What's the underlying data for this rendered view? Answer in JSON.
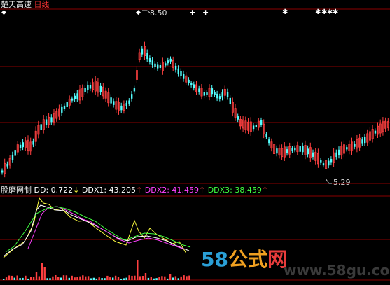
{
  "header": {
    "stock_name": "楚天高速",
    "period": "日线"
  },
  "price_panel": {
    "max_label": "8.50",
    "min_label": "5.29",
    "colors": {
      "up": "#ff4040",
      "down": "#54ffff",
      "grid": "#8b0000"
    },
    "signal_marker": "diamond-icon",
    "signal_star_marker": "star-icon"
  },
  "indicator_panel": {
    "name": "股磨网制",
    "dd_label": "DD:",
    "dd_value": "0.722",
    "dd_arrow": "↓",
    "ddx1_label": "DDX1:",
    "ddx1_value": "43.205",
    "ddx1_arrow": "↑",
    "ddx2_label": "DDX2:",
    "ddx2_value": "41.459",
    "ddx2_arrow": "↑",
    "ddx3_label": "DDX3:",
    "ddx3_value": "38.459",
    "ddx3_arrow": "↑",
    "colors": {
      "dd": "#ffff40",
      "ddx1": "#ffffff",
      "ddx2": "#ff40ff",
      "ddx3": "#40ff40"
    }
  },
  "watermark": {
    "n58": "58",
    "gongshi": "公式",
    "wang": "网",
    "url": "www.58gu.com"
  }
}
